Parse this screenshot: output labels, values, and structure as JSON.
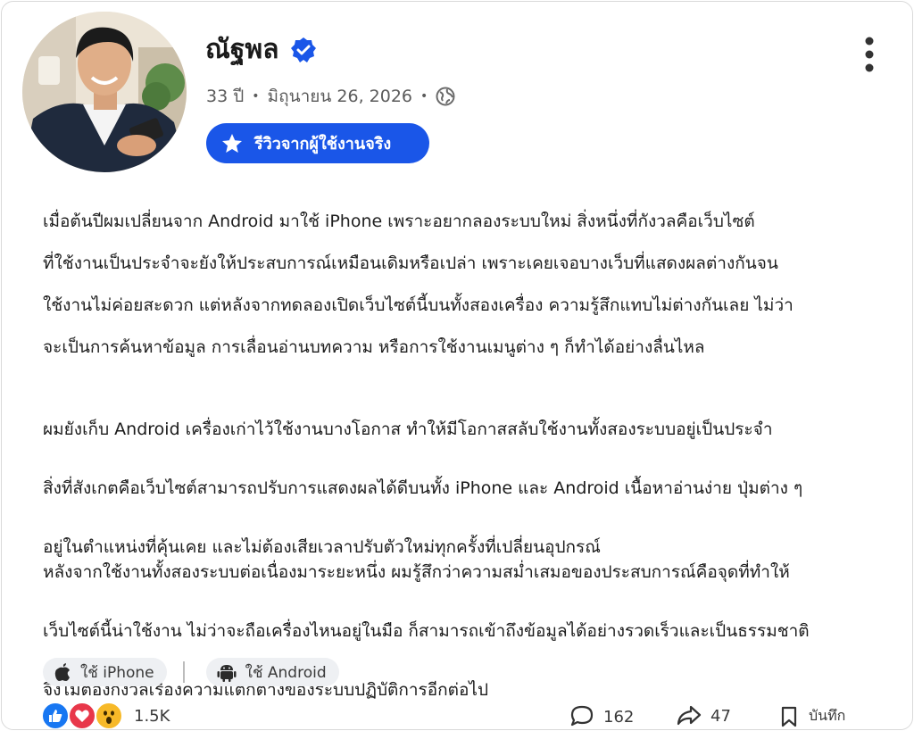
{
  "author": {
    "name": "ณัฐพล",
    "age": "33 ปี",
    "date": "มิถุนายน 26, 2026",
    "separator": "•"
  },
  "badge": {
    "label": "รีวิวจากผู้ใช้งานจริง"
  },
  "post": {
    "paragraph1": [
      "เมื่อต้นปีผมเปลี่ยนจาก Android มาใช้ iPhone เพราะอยากลองระบบใหม่ สิ่งหนึ่งที่กังวลคือเว็บไซต์",
      "ที่ใช้งานเป็นประจำจะยังให้ประสบการณ์เหมือนเดิมหรือเปล่า เพราะเคยเจอบางเว็บที่แสดงผลต่างกันจน",
      "ใช้งานไม่ค่อยสะดวก แต่หลังจากทดลองเปิดเว็บไซต์นี้บนทั้งสองเครื่อง ความรู้สึกแทบไม่ต่างกันเลย ไม่ว่า",
      "จะเป็นการค้นหาข้อมูล การเลื่อนอ่านบทความ หรือการใช้งานเมนูต่าง ๆ ก็ทำได้อย่างลื่นไหล"
    ],
    "paragraph2": [
      "ผมยังเก็บ Android เครื่องเก่าไว้ใช้งานบางโอกาส ทำให้มีโอกาสสลับใช้งานทั้งสองระบบอยู่เป็นประจำ",
      "สิ่งที่สังเกตคือเว็บไซต์สามารถปรับการแสดงผลได้ดีบนทั้ง iPhone และ Android เนื้อหาอ่านง่าย ปุ่มต่าง ๆ",
      "อยู่ในตำแหน่งที่คุ้นเคย และไม่ต้องเสียเวลาปรับตัวใหม่ทุกครั้งที่เปลี่ยนอุปกรณ์"
    ],
    "paragraph3": [
      "หลังจากใช้งานทั้งสองระบบต่อเนื่องมาระยะหนึ่ง ผมรู้สึกว่าความสม่ำเสมอของประสบการณ์คือจุดที่ทำให้",
      "เว็บไซต์นี้น่าใช้งาน ไม่ว่าจะถือเครื่องไหนอยู่ในมือ ก็สามารถเข้าถึงข้อมูลได้อย่างรวดเร็วและเป็นธรรมชาติ",
      "จึงไม่ต้องกังวลเรื่องความแตกต่างของระบบปฏิบัติการอีกต่อไป"
    ]
  },
  "device_tags": [
    {
      "icon": "apple-icon",
      "label": "ใช้ iPhone"
    },
    {
      "icon": "android-icon",
      "label": "ใช้ Android"
    }
  ],
  "footer": {
    "reaction_count": "1.5K",
    "comments": "162",
    "shares": "47",
    "save_label": "บันทึก"
  },
  "colors": {
    "accent": "#1a56e8",
    "like": "#1877f2",
    "love": "#e8374a",
    "wow": "#f7b928",
    "chip_bg": "#eef0f3"
  }
}
